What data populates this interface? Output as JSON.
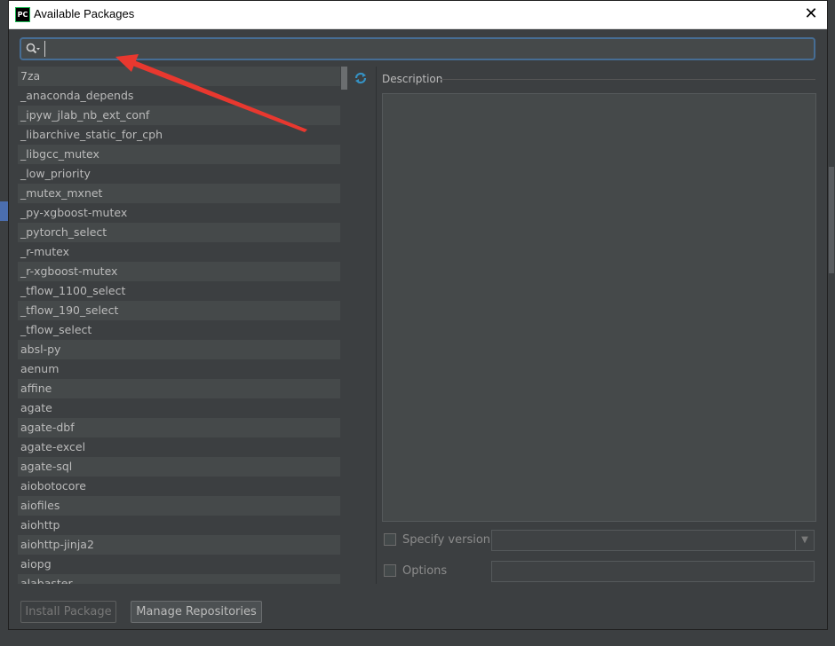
{
  "dialog": {
    "title": "Available Packages",
    "app_icon_text": "PC",
    "close_symbol": "✕"
  },
  "search": {
    "value": "",
    "placeholder": ""
  },
  "packages": [
    "7za",
    "_anaconda_depends",
    "_ipyw_jlab_nb_ext_conf",
    "_libarchive_static_for_cph",
    "_libgcc_mutex",
    "_low_priority",
    "_mutex_mxnet",
    "_py-xgboost-mutex",
    "_pytorch_select",
    "_r-mutex",
    "_r-xgboost-mutex",
    "_tflow_1100_select",
    "_tflow_190_select",
    "_tflow_select",
    "absl-py",
    "aenum",
    "affine",
    "agate",
    "agate-dbf",
    "agate-excel",
    "agate-sql",
    "aiobotocore",
    "aiofiles",
    "aiohttp",
    "aiohttp-jinja2",
    "aiopg",
    "alabaster"
  ],
  "description": {
    "label": "Description",
    "text": ""
  },
  "options": {
    "specify_version_label": "Specify version",
    "specify_version_checked": false,
    "options_label": "Options",
    "options_checked": false,
    "version_value": "",
    "options_value": ""
  },
  "buttons": {
    "install": "Install Package",
    "manage": "Manage Repositories"
  },
  "colors": {
    "annotation_arrow": "#e8382f",
    "search_focus": "#466d94",
    "refresh_icon": "#3592c4"
  },
  "icons": {
    "search": "search-icon",
    "refresh": "refresh-icon",
    "dropdown": "chevron-down-icon"
  }
}
